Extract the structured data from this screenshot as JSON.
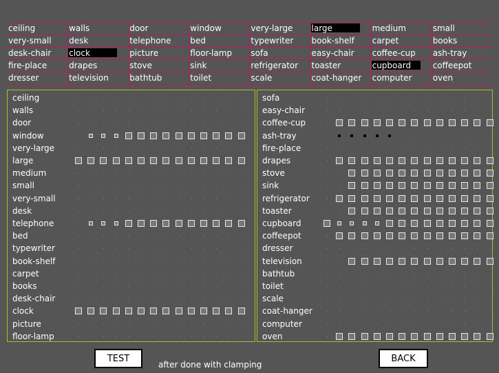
{
  "word_grid": [
    [
      {
        "text": "ceiling"
      },
      {
        "text": "walls"
      },
      {
        "text": "door"
      },
      {
        "text": "window"
      },
      {
        "text": "very-large"
      },
      {
        "text": "large",
        "selected": true
      },
      {
        "text": "medium"
      },
      {
        "text": "small"
      }
    ],
    [
      {
        "text": "very-small"
      },
      {
        "text": "desk"
      },
      {
        "text": "telephone"
      },
      {
        "text": "bed"
      },
      {
        "text": "typewriter"
      },
      {
        "text": "book-shelf"
      },
      {
        "text": "carpet"
      },
      {
        "text": "books"
      }
    ],
    [
      {
        "text": "desk-chair"
      },
      {
        "text": "clock",
        "selected": true
      },
      {
        "text": "picture"
      },
      {
        "text": "floor-lamp"
      },
      {
        "text": "sofa"
      },
      {
        "text": "easy-chair"
      },
      {
        "text": "coffee-cup"
      },
      {
        "text": "ash-tray"
      }
    ],
    [
      {
        "text": "fire-place"
      },
      {
        "text": "drapes"
      },
      {
        "text": "stove"
      },
      {
        "text": "sink"
      },
      {
        "text": "refrigerator"
      },
      {
        "text": "toaster"
      },
      {
        "text": "cupboard",
        "selected": true
      },
      {
        "text": "coffeepot"
      }
    ],
    [
      {
        "text": "dresser"
      },
      {
        "text": "television"
      },
      {
        "text": "bathtub"
      },
      {
        "text": "toilet"
      },
      {
        "text": "scale"
      },
      {
        "text": "coat-hanger"
      },
      {
        "text": "computer"
      },
      {
        "text": "oven"
      }
    ]
  ],
  "left_panel": {
    "rows": [
      {
        "label": "ceiling",
        "cells": "dddddddddddddd"
      },
      {
        "label": "walls",
        "cells": "dddddddddddddd"
      },
      {
        "label": "door",
        "cells": "dddddddddddddd"
      },
      {
        "label": "window",
        "cells": "dsssLLLLLLLLLL"
      },
      {
        "label": "very-large",
        "cells": "dddddddddddddd"
      },
      {
        "label": "large",
        "cells": "LLLLLLLLLLLLLL"
      },
      {
        "label": "medium",
        "cells": "dddddddddddddd"
      },
      {
        "label": "small",
        "cells": "dddddddddddddd"
      },
      {
        "label": "very-small",
        "cells": "dddddddddddddd"
      },
      {
        "label": "desk",
        "cells": "dddddddddddddd"
      },
      {
        "label": "telephone",
        "cells": "dsssLLLLLLLLLL"
      },
      {
        "label": "bed",
        "cells": "dddddddddddddd"
      },
      {
        "label": "typewriter",
        "cells": "dddddddddddddd"
      },
      {
        "label": "book-shelf",
        "cells": "dddddddddddddd"
      },
      {
        "label": "carpet",
        "cells": "dddddddddddddd"
      },
      {
        "label": "books",
        "cells": "dddddddddddddd"
      },
      {
        "label": "desk-chair",
        "cells": "dddddddddddddd"
      },
      {
        "label": "clock",
        "cells": "LLLLLLLLLLLLLL"
      },
      {
        "label": "picture",
        "cells": "dddddddddddddd"
      },
      {
        "label": "floor-lamp",
        "cells": "dddddddddddddd"
      }
    ]
  },
  "right_panel": {
    "rows": [
      {
        "label": "sofa",
        "cells": "dddddddddddddd"
      },
      {
        "label": "easy-chair",
        "cells": "dddddddddddddd"
      },
      {
        "label": "coffee-cup",
        "cells": "dLLLLLLLLLLLLL"
      },
      {
        "label": "ash-tray",
        "cells": "dkkkkkdddddddd"
      },
      {
        "label": "fire-place",
        "cells": "dddddddddddddd"
      },
      {
        "label": "drapes",
        "cells": "dLLLLLLLLLLLLL"
      },
      {
        "label": "stove",
        "cells": "ddLLLLLLLLLLLL"
      },
      {
        "label": "sink",
        "cells": "ddLLLLLLLLLLLL"
      },
      {
        "label": "refrigerator",
        "cells": "dLLLLLLLLLLLLL"
      },
      {
        "label": "toaster",
        "cells": "ddLLLLLLLLLLLL"
      },
      {
        "label": "cupboard",
        "cells": "LssssLLLLLLLLLL"
      },
      {
        "label": "coffeepot",
        "cells": "dLLLLLLLLLLLLL"
      },
      {
        "label": "dresser",
        "cells": "dddddddddddddd"
      },
      {
        "label": "television",
        "cells": "ddLLLLLLLLLLLL"
      },
      {
        "label": "bathtub",
        "cells": "dddddddddddddd"
      },
      {
        "label": "toilet",
        "cells": "dddddddddddddd"
      },
      {
        "label": "scale",
        "cells": "dddddddddddddd"
      },
      {
        "label": "coat-hanger",
        "cells": "dddddddddddddd"
      },
      {
        "label": "computer",
        "cells": "dddddddddddddd"
      },
      {
        "label": "oven",
        "cells": "dLLLLLLLLLLLLL"
      }
    ]
  },
  "buttons": {
    "test": "TEST",
    "back": "BACK"
  },
  "caption": "after done with clamping",
  "colors": {
    "background": "#555555",
    "grid_lines": "#c0185a",
    "panel_border": "#b5b82a",
    "selection": "#000000"
  }
}
